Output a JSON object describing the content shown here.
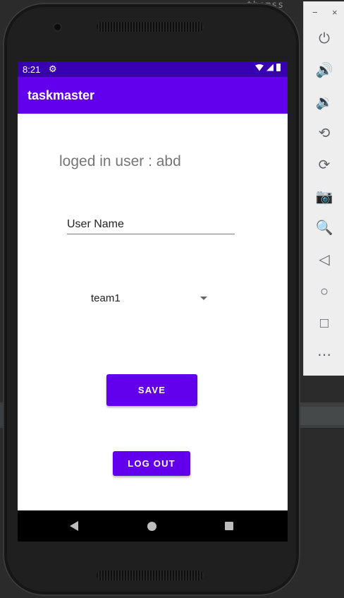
{
  "ide": {
    "background_text": "themss"
  },
  "status_bar": {
    "time": "8:21"
  },
  "app_bar": {
    "title": "taskmaster"
  },
  "main": {
    "user_label": "loged in user : abd",
    "username_input": {
      "placeholder": "User Name",
      "value": ""
    },
    "team_spinner": {
      "selected": "team1"
    },
    "save_button": "SAVE",
    "logout_button": "LOG OUT"
  },
  "emulator_panel": {
    "window_controls": [
      "−",
      "×"
    ],
    "buttons": [
      "power-icon",
      "volume-up-icon",
      "volume-down-icon",
      "rotate-left-icon",
      "rotate-right-icon",
      "camera-icon",
      "zoom-icon",
      "back-icon",
      "home-icon",
      "overview-icon",
      "more-icon"
    ]
  },
  "colors": {
    "primary": "#6200ee",
    "primary_dark": "#3700b3"
  }
}
